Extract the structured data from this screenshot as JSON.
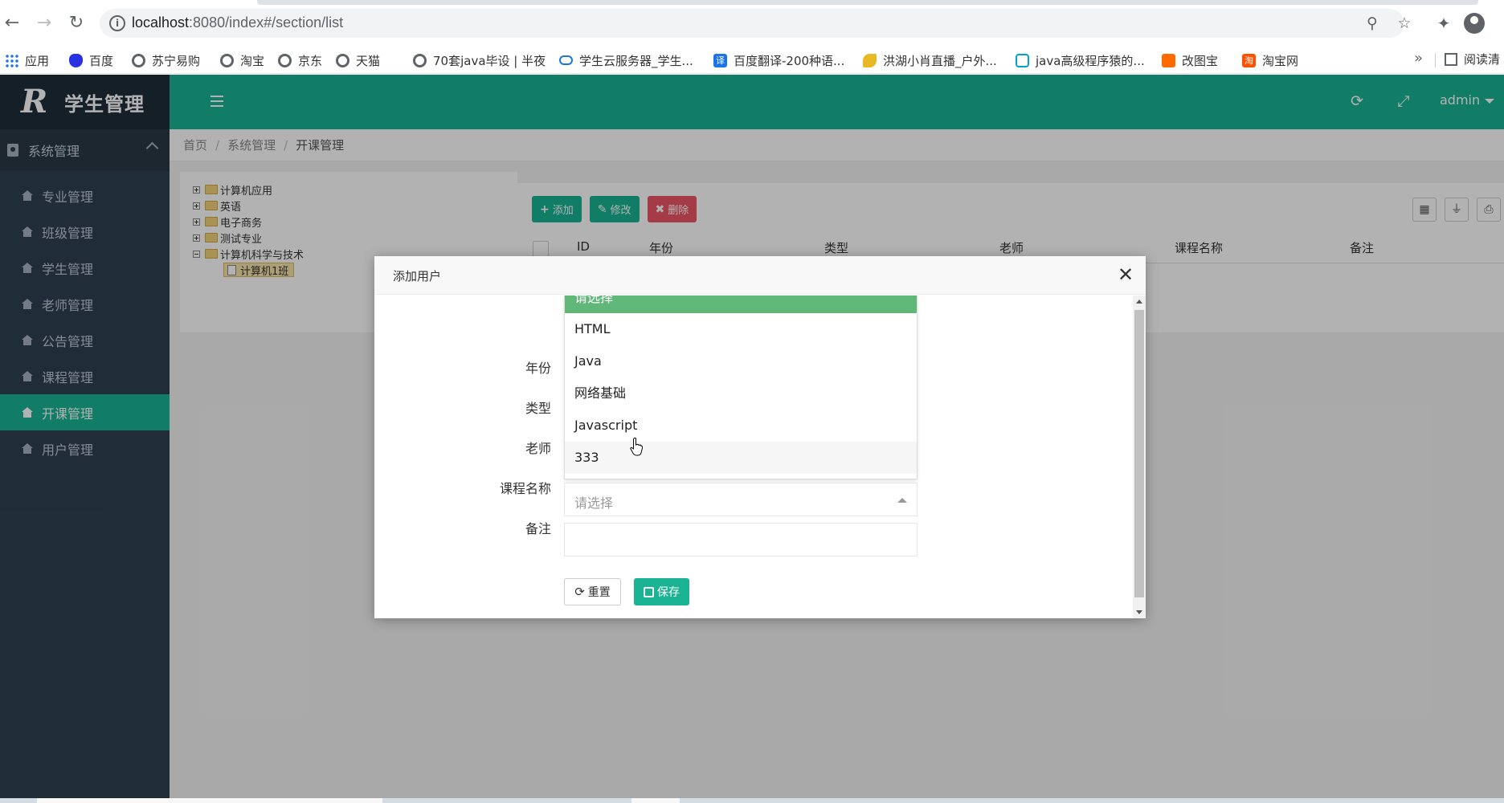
{
  "browser": {
    "url_host": "localhost",
    "url_rest": ":8080/index#/section/list",
    "bookmarks": [
      {
        "label": "应用",
        "icon": "apps-grid-icon"
      },
      {
        "label": "百度",
        "icon": "baidu-paw-icon"
      },
      {
        "label": "苏宁易购",
        "icon": "globe-icon"
      },
      {
        "label": "淘宝",
        "icon": "globe-icon"
      },
      {
        "label": "京东",
        "icon": "globe-icon"
      },
      {
        "label": "天猫",
        "icon": "globe-icon"
      },
      {
        "label": "70套java毕设 | 半夜",
        "icon": "globe-icon"
      },
      {
        "label": "学生云服务器_学生...",
        "icon": "cloud-icon"
      },
      {
        "label": "百度翻译-200种语...",
        "icon": "translate-icon"
      },
      {
        "label": "洪湖小肖直播_户外...",
        "icon": "bird-icon"
      },
      {
        "label": "java高级程序猿的...",
        "icon": "bilibili-tv-icon"
      },
      {
        "label": "改图宝",
        "icon": "orange-square-icon"
      },
      {
        "label": "淘宝网",
        "icon": "taobao-icon"
      }
    ],
    "more": "»",
    "reading_list": "阅读清"
  },
  "app": {
    "logo_letter": "R",
    "title": "学生管理",
    "user": "admin",
    "sidebar": {
      "group_label": "系统管理",
      "items": [
        {
          "label": "专业管理",
          "active": false
        },
        {
          "label": "班级管理",
          "active": false
        },
        {
          "label": "学生管理",
          "active": false
        },
        {
          "label": "老师管理",
          "active": false
        },
        {
          "label": "公告管理",
          "active": false
        },
        {
          "label": "课程管理",
          "active": false
        },
        {
          "label": "开课管理",
          "active": true
        },
        {
          "label": "用户管理",
          "active": false
        }
      ]
    },
    "breadcrumb": [
      "首页",
      "系统管理",
      "开课管理"
    ],
    "tree": [
      {
        "label": "计算机应用",
        "expanded": false
      },
      {
        "label": "英语",
        "expanded": false
      },
      {
        "label": "电子商务",
        "expanded": false
      },
      {
        "label": "测试专业",
        "expanded": false
      },
      {
        "label": "计算机科学与技术",
        "expanded": true
      },
      {
        "label": "计算机1班",
        "leaf": true,
        "selected": true
      }
    ],
    "toolbar": {
      "add": "添加",
      "edit": "修改",
      "delete": "删除"
    },
    "table_columns": [
      "ID",
      "年份",
      "类型",
      "老师",
      "课程名称",
      "备注"
    ]
  },
  "modal": {
    "title": "添加用户",
    "labels": {
      "year": "年份",
      "type": "类型",
      "teacher": "老师",
      "course": "课程名称",
      "remark": "备注"
    },
    "course_placeholder": "请选择",
    "dropdown_options": [
      "请选择",
      "HTML",
      "Java",
      "网络基础",
      "Javascript",
      "333"
    ],
    "dropdown_selected_index": 0,
    "dropdown_hover_index": 5,
    "reset_label": "重置",
    "save_label": "保存"
  },
  "colors": {
    "teal": "#1ab394",
    "red": "#ed5565",
    "sidebar": "#2f4050",
    "selected_option": "#5fb878"
  }
}
